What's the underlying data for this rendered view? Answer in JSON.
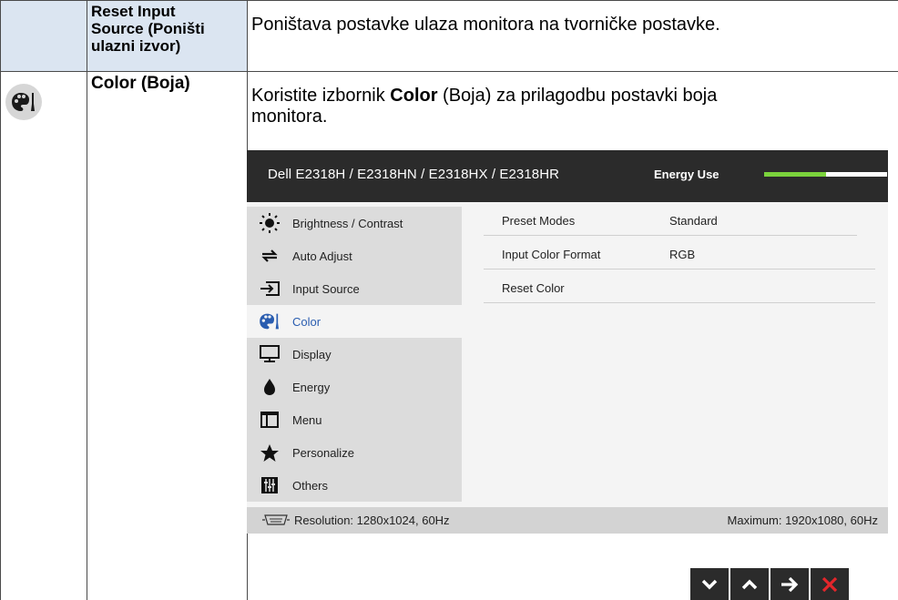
{
  "rows": [
    {
      "term": "Reset Input Source (Poništi ulazni izvor)",
      "term_lines": [
        "Reset Input",
        "Source (Poništi",
        "ulazni izvor)"
      ],
      "description": "Poništava postavke ulaza monitora na tvorničke postavke."
    },
    {
      "icon": "color-palette-icon",
      "term": "Color (Boja)",
      "description_parts": {
        "before": "Koristite izbornik ",
        "bold": "Color",
        "after_line1": " (Boja) za prilagodbu postavki boja",
        "line2": "monitora."
      }
    }
  ],
  "osd": {
    "title": "Dell E2318H / E2318HN / E2318HX / E2318HR",
    "energy_label": "Energy Use",
    "energy_level_fraction": 0.5,
    "menu": [
      {
        "label": "Brightness / Contrast",
        "icon": "brightness-icon",
        "selected": false
      },
      {
        "label": "Auto Adjust",
        "icon": "auto-adjust-icon",
        "selected": false
      },
      {
        "label": "Input Source",
        "icon": "input-source-icon",
        "selected": false
      },
      {
        "label": "Color",
        "icon": "color-palette-icon",
        "selected": true
      },
      {
        "label": "Display",
        "icon": "display-icon",
        "selected": false
      },
      {
        "label": "Energy",
        "icon": "energy-icon",
        "selected": false
      },
      {
        "label": "Menu",
        "icon": "menu-icon",
        "selected": false
      },
      {
        "label": "Personalize",
        "icon": "star-icon",
        "selected": false
      },
      {
        "label": "Others",
        "icon": "others-icon",
        "selected": false
      }
    ],
    "settings": [
      {
        "label": "Preset Modes",
        "value": "Standard"
      },
      {
        "label": "Input Color Format",
        "value": "RGB"
      },
      {
        "label": "Reset Color",
        "value": ""
      }
    ],
    "footer": {
      "resolution": "Resolution: 1280x1024, 60Hz",
      "maximum": "Maximum: 1920x1080, 60Hz"
    },
    "nav_buttons": [
      "down-arrow-icon",
      "up-arrow-icon",
      "right-arrow-icon",
      "close-icon"
    ],
    "colors": {
      "header_bg": "#2b2b2b",
      "energy_fill": "#7bd33c",
      "selected_text": "#2a5db0",
      "close_red": "#e3262b"
    }
  }
}
